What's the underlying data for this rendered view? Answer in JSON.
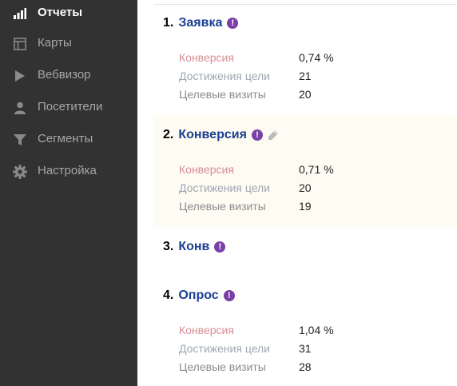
{
  "sidebar": {
    "items": [
      {
        "label": "Отчеты",
        "icon": "bar-chart-icon",
        "active": true
      },
      {
        "label": "Карты",
        "icon": "layout-icon",
        "active": false
      },
      {
        "label": "Вебвизор",
        "icon": "play-icon",
        "active": false
      },
      {
        "label": "Посетители",
        "icon": "user-icon",
        "active": false
      },
      {
        "label": "Сегменты",
        "icon": "filter-icon",
        "active": false
      },
      {
        "label": "Настройка",
        "icon": "gear-icon",
        "active": false
      }
    ]
  },
  "metric_labels": {
    "conversion": "Конверсия",
    "achievements": "Достижения цели",
    "visits": "Целевые визиты"
  },
  "goals": [
    {
      "number": "1.",
      "title": "Заявка",
      "badge": "!",
      "conversion": "0,74 %",
      "achievements": "21",
      "visits": "20"
    },
    {
      "number": "2.",
      "title": "Конверсия",
      "badge": "!",
      "editable_icon": "pencil-icon",
      "conversion": "0,71 %",
      "achievements": "20",
      "visits": "19"
    },
    {
      "number": "3.",
      "title": "Конв",
      "badge": "!"
    },
    {
      "number": "4.",
      "title": "Опрос",
      "badge": "!",
      "conversion": "1,04 %",
      "achievements": "31",
      "visits": "28"
    }
  ],
  "colors": {
    "sidebar_bg": "#323232",
    "goal_title": "#1c3f94",
    "badge": "#7b3fa8",
    "highlight_bg": "#fdfbf2"
  }
}
